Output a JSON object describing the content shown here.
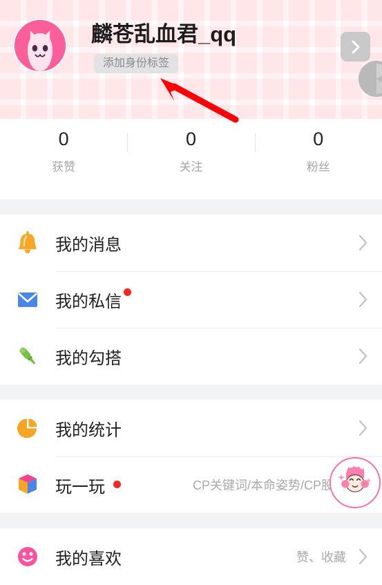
{
  "profile": {
    "display_name": "麟苍乱血君_qq",
    "identity_tag_label": "添加身份标签",
    "avatar_icon": "cat-avatar-icon",
    "next_button_icon": "chevron-right-icon",
    "edge_widget_icon": "partial-gray-disc-icon",
    "annotation_icon": "red-arrow-annotation"
  },
  "stats": [
    {
      "value": "0",
      "label": "获赞"
    },
    {
      "value": "0",
      "label": "关注"
    },
    {
      "value": "0",
      "label": "粉丝"
    }
  ],
  "groups": [
    {
      "rows": [
        {
          "label": "我的消息",
          "sub": "",
          "icon": "bell-icon",
          "badge": false
        },
        {
          "label": "我的私信",
          "sub": "",
          "icon": "envelope-icon",
          "badge": true
        },
        {
          "label": "我的勾搭",
          "sub": "",
          "icon": "microphone-icon",
          "badge": false
        }
      ]
    },
    {
      "rows": [
        {
          "label": "我的统计",
          "sub": "",
          "icon": "pie-chart-icon",
          "badge": false
        },
        {
          "label": "玩一玩",
          "sub": "CP关键词/本命姿势/CP股市",
          "icon": "cube-icon",
          "badge": true
        }
      ]
    },
    {
      "rows": [
        {
          "label": "我的喜欢",
          "sub": "赞、收藏",
          "icon": "smiley-icon",
          "badge": false
        }
      ]
    }
  ],
  "mascot": {
    "icon": "mascot-avatar-icon"
  },
  "colors": {
    "accent_pink": "#fa5f9a",
    "badge_red": "#f5271f",
    "bell_orange": "#f5a623",
    "envelope_blue": "#4a86e8",
    "microphone_green": "#6fbf3f",
    "band_gray": "#f2f3f5",
    "annotation_red": "#fb0007"
  }
}
